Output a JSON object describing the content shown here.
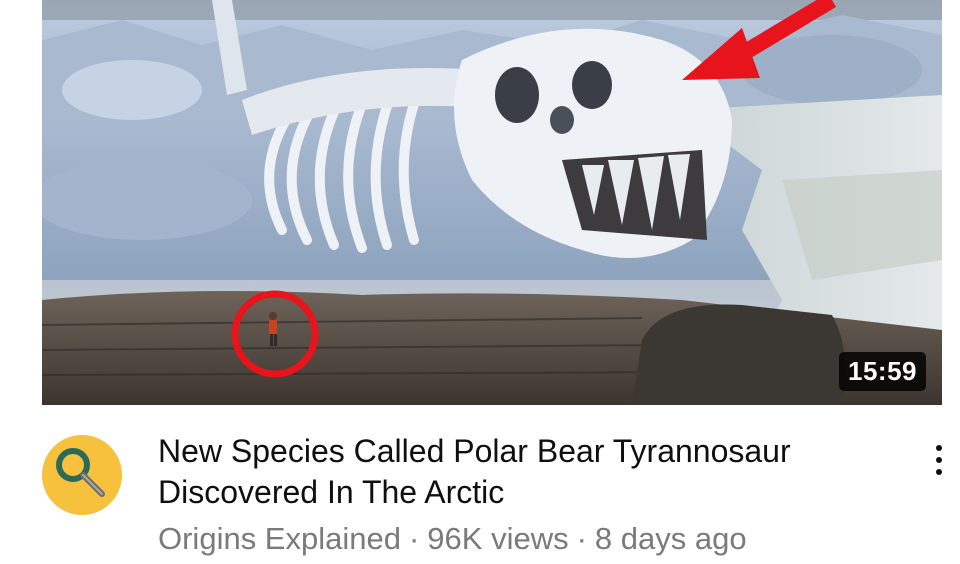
{
  "video": {
    "duration": "15:59",
    "title": "New Species Called Polar Bear Tyrannosaur Discovered In The Arctic",
    "channel": "Origins Explained",
    "views": "96K views",
    "age": "8 days ago",
    "separator": "·"
  },
  "icons": {
    "avatar": "magnifier-logo-icon",
    "more": "more-vertical-icon",
    "arrow": "red-arrow-annotation",
    "circle": "red-circle-annotation"
  },
  "colors": {
    "title": "#0f0f0f",
    "subtitle": "#7a7a7a",
    "avatar_bg": "#f6c23e",
    "annotation_red": "#e8141b",
    "duration_bg": "#000000"
  }
}
